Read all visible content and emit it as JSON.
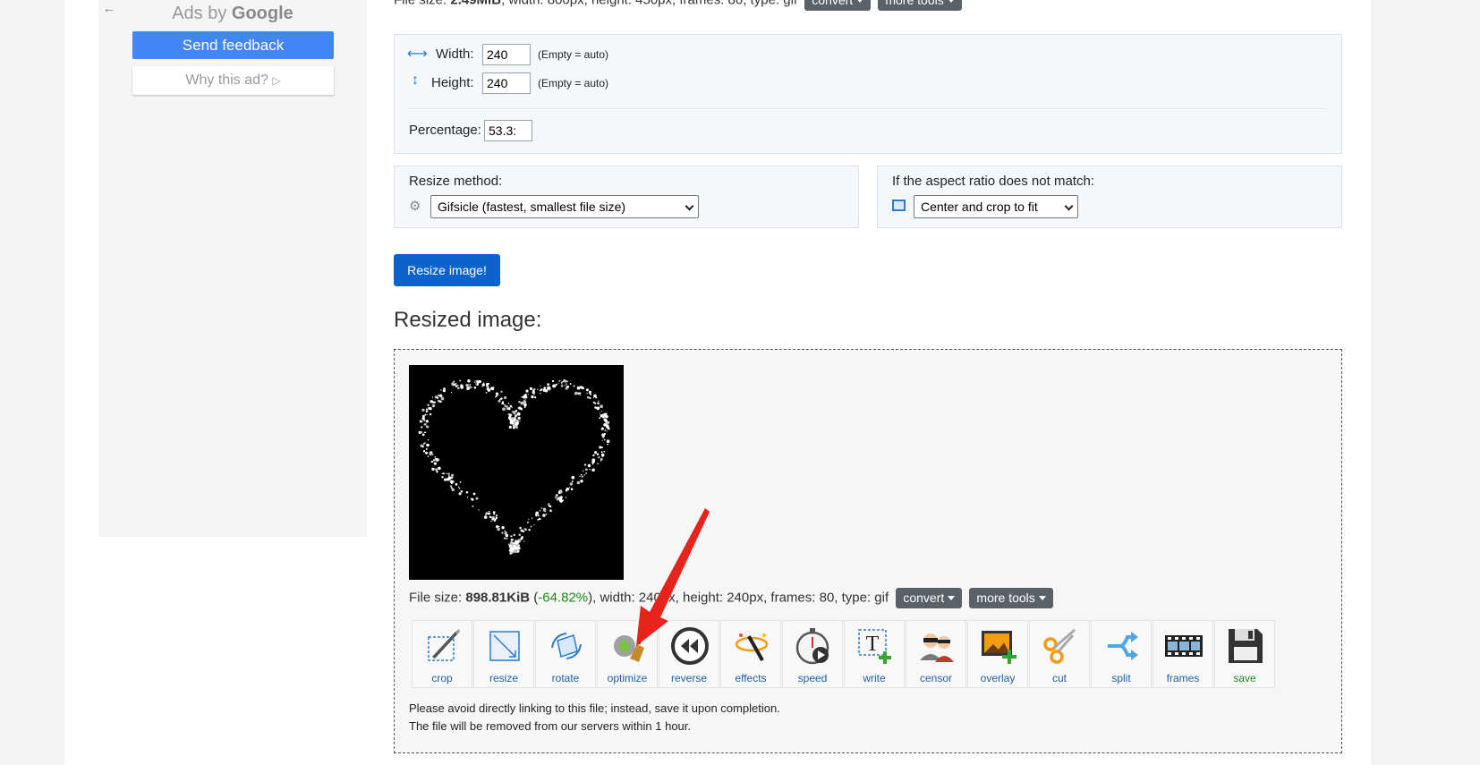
{
  "ad": {
    "header_prefix": "Ads by",
    "header_brand": "Google",
    "send_feedback": "Send feedback",
    "why_this_ad": "Why this ad?"
  },
  "original": {
    "info_prefix": "File size: ",
    "size": "2.49MiB",
    "info_rest": ", width: 800px, height: 450px, frames: 80, type: gif",
    "convert": "convert",
    "more_tools": "more tools"
  },
  "dimensions": {
    "width_label": "Width:",
    "width_value": "240",
    "width_hint": "(Empty = auto)",
    "height_label": "Height:",
    "height_value": "240",
    "height_hint": "(Empty = auto)",
    "percentage_label": "Percentage:",
    "percentage_value": "53.3:"
  },
  "method": {
    "label": "Resize method:",
    "selected": "Gifsicle (fastest, smallest file size)"
  },
  "aspect": {
    "label": "If the aspect ratio does not match:",
    "selected": "Center and crop to fit"
  },
  "resize_button": "Resize image!",
  "result": {
    "heading": "Resized image:",
    "info_prefix": "File size: ",
    "size": "898.81KiB",
    "open_paren": " (",
    "pct": "-64.82%",
    "info_rest": "), width: 240px, height: 240px, frames: 80, type: gif",
    "convert": "convert",
    "more_tools": "more tools",
    "note1": "Please avoid directly linking to this file; instead, save it upon completion.",
    "note2": "The file will be removed from our servers within 1 hour."
  },
  "tools": [
    {
      "label": "crop",
      "icon": "crop-icon"
    },
    {
      "label": "resize",
      "icon": "resize-icon"
    },
    {
      "label": "rotate",
      "icon": "rotate-icon"
    },
    {
      "label": "optimize",
      "icon": "broom-icon"
    },
    {
      "label": "reverse",
      "icon": "rewind-icon"
    },
    {
      "label": "effects",
      "icon": "magic-wand-icon"
    },
    {
      "label": "speed",
      "icon": "stopwatch-icon"
    },
    {
      "label": "write",
      "icon": "text-icon"
    },
    {
      "label": "censor",
      "icon": "censor-icon"
    },
    {
      "label": "overlay",
      "icon": "overlay-icon"
    },
    {
      "label": "cut",
      "icon": "scissors-icon"
    },
    {
      "label": "split",
      "icon": "split-icon"
    },
    {
      "label": "frames",
      "icon": "film-icon"
    },
    {
      "label": "save",
      "icon": "floppy-icon"
    }
  ],
  "colors": {
    "primary": "#0d63c9",
    "google_blue": "#4285f4",
    "success": "#1a8a1a",
    "annotation": "#e8231c"
  }
}
